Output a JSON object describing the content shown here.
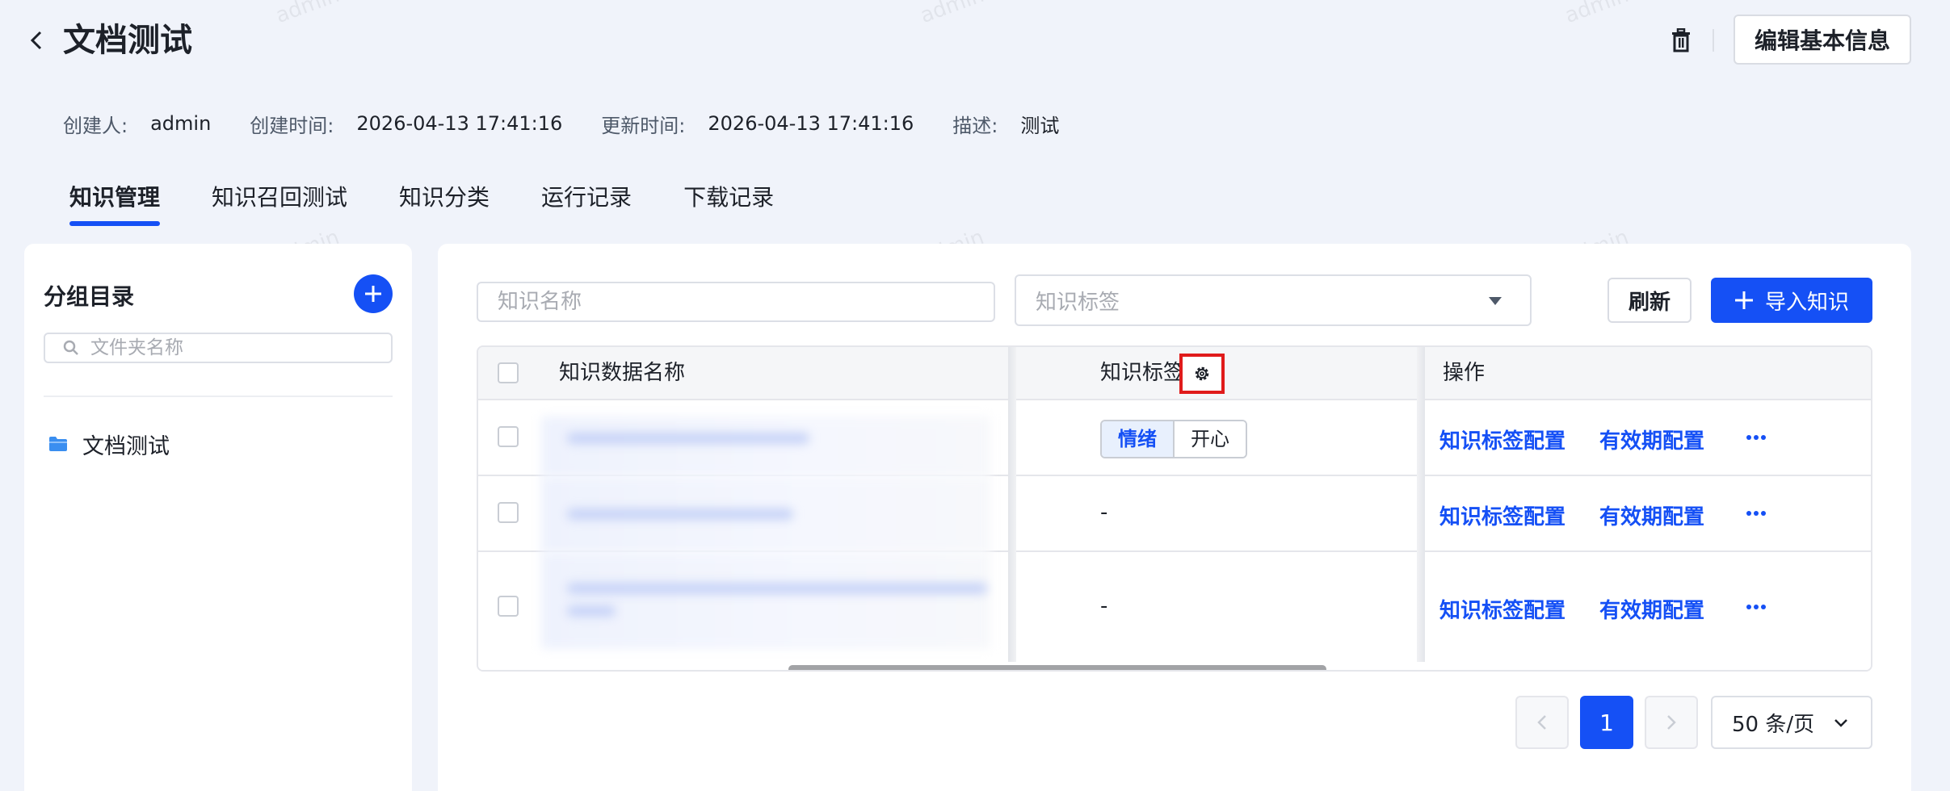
{
  "header": {
    "title": "文档测试",
    "edit_button": "编辑基本信息"
  },
  "meta": {
    "creator_label": "创建人:",
    "creator": "admin",
    "created_label": "创建时间:",
    "created": "2026-04-13 17:41:16",
    "updated_label": "更新时间:",
    "updated": "2026-04-13 17:41:16",
    "desc_label": "描述:",
    "desc": "测试"
  },
  "tabs": [
    {
      "label": "知识管理",
      "active": true
    },
    {
      "label": "知识召回测试",
      "active": false
    },
    {
      "label": "知识分类",
      "active": false
    },
    {
      "label": "运行记录",
      "active": false
    },
    {
      "label": "下载记录",
      "active": false
    }
  ],
  "sidebar": {
    "title": "分组目录",
    "search_placeholder": "文件夹名称",
    "folders": [
      {
        "label": "文档测试"
      }
    ]
  },
  "toolbar": {
    "name_placeholder": "知识名称",
    "tag_placeholder": "知识标签",
    "refresh": "刷新",
    "import": "导入知识"
  },
  "table": {
    "columns": {
      "name": "知识数据名称",
      "tags": "知识标签",
      "ops": "操作"
    },
    "rows": [
      {
        "tags": [
          "情绪",
          "开心"
        ],
        "tag_text": "",
        "op1": "知识标签配置",
        "op2": "有效期配置"
      },
      {
        "tags": [],
        "tag_text": "-",
        "op1": "知识标签配置",
        "op2": "有效期配置"
      },
      {
        "tags": [],
        "tag_text": "-",
        "op1": "知识标签配置",
        "op2": "有效期配置"
      }
    ]
  },
  "pagination": {
    "current": "1",
    "page_size": "50 条/页"
  },
  "watermark": "admin",
  "colors": {
    "primary": "#1550f5",
    "highlight_box": "#e01b1b",
    "page_bg": "#f0f3fa"
  },
  "icons": [
    "back-arrow-icon",
    "trash-icon",
    "plus-icon",
    "search-icon",
    "folder-icon",
    "chevron-down-icon",
    "gear-icon",
    "more-icon",
    "chevron-left-icon",
    "chevron-right-icon"
  ]
}
